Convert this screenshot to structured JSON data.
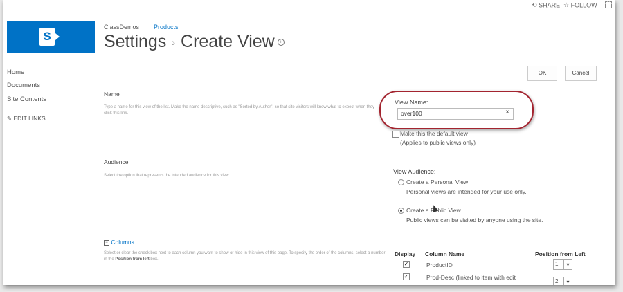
{
  "topbar": {
    "share_label": "SHARE",
    "follow_label": "FOLLOW"
  },
  "breadcrumb": {
    "site": "ClassDemos",
    "list": "Products"
  },
  "page_title": {
    "part1": "Settings",
    "separator": "›",
    "part2": "Create View"
  },
  "nav": {
    "items": [
      "Home",
      "Documents",
      "Site Contents"
    ],
    "edit_links": "EDIT LINKS"
  },
  "buttons": {
    "ok": "OK",
    "cancel": "Cancel"
  },
  "name_section": {
    "title": "Name",
    "description": "Type a name for this view of the list. Make the name descriptive, such as \"Sorted by Author\", so that site visitors will know what to expect when they click this link.",
    "field_label": "View Name:",
    "field_value": "over100",
    "default_checkbox_label": "Make this the default view",
    "default_checkbox_hint": "(Applies to public views only)"
  },
  "audience_section": {
    "title": "Audience",
    "description": "Select the option that represents the intended audience for this view.",
    "label": "View Audience:",
    "personal_label": "Create a Personal View",
    "personal_hint": "Personal views are intended for your use only.",
    "public_label": "Create a Public View",
    "public_hint": "Public views can be visited by anyone using the site.",
    "selected": "public"
  },
  "columns_section": {
    "title": "Columns",
    "description_part1": "Select or clear the check box next to each column you want to show or hide in this view of this page. To specify the order of the columns, select a number in the ",
    "description_bold": "Position from left",
    "description_part2": " box.",
    "headers": {
      "display": "Display",
      "column_name": "Column Name",
      "position": "Position from Left"
    },
    "rows": [
      {
        "checked": true,
        "name": "ProductID",
        "position": "1"
      },
      {
        "checked": true,
        "name": "Prod-Desc (linked to item with edit",
        "position": "2"
      }
    ]
  },
  "icons": {
    "share": "share-icon",
    "follow": "star-icon",
    "focus": "focus-mode-icon",
    "info": "info-icon",
    "pencil": "pencil-icon",
    "collapse": "collapse-minus-icon",
    "chevron": "chevron-down-icon"
  },
  "colors": {
    "brand": "#0072c6",
    "callout": "#a3242f"
  }
}
